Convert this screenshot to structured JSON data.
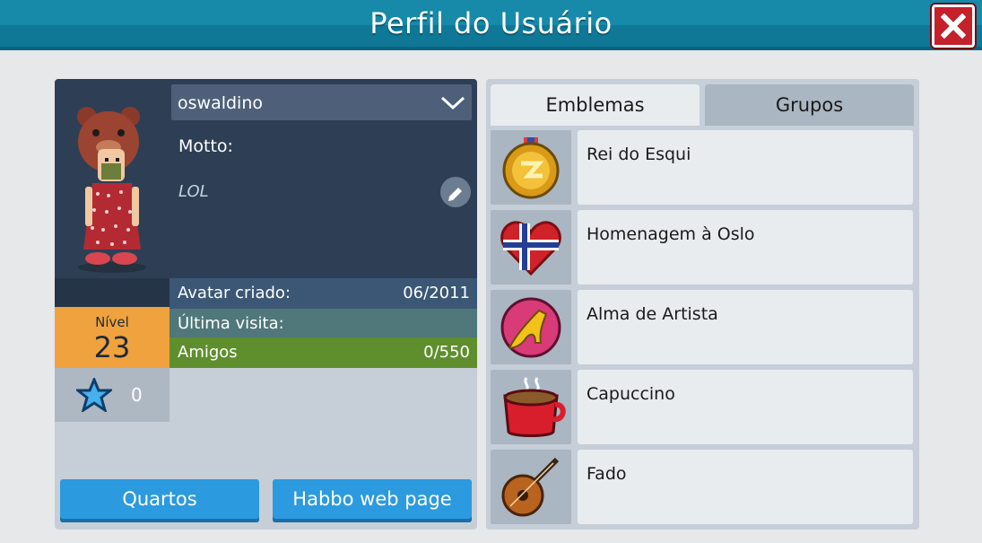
{
  "window": {
    "title": "Perfil do Usuário",
    "close_icon": "close-icon"
  },
  "profile": {
    "username": "oswaldino",
    "motto_label": "Motto:",
    "motto_value": "LOL",
    "stats": {
      "created_label": "Avatar criado:",
      "created_value": "06/2011",
      "last_visit_label": "Última visita:",
      "last_visit_value": "",
      "friends_label": "Amigos",
      "friends_value": "0/550"
    },
    "level_label": "Nível",
    "level_value": "23",
    "stars_value": "0"
  },
  "buttons": {
    "rooms": "Quartos",
    "web_page": "Habbo web page"
  },
  "tabs": [
    {
      "label": "Emblemas",
      "active": true
    },
    {
      "label": "Grupos",
      "active": false
    }
  ],
  "badges": [
    {
      "label": "Rei do Esqui",
      "icon": "gold-medal-icon"
    },
    {
      "label": "Homenagem à Oslo",
      "icon": "norway-heart-icon"
    },
    {
      "label": "Alma de Artista",
      "icon": "high-heel-icon"
    },
    {
      "label": "Capuccino",
      "icon": "coffee-cup-icon"
    },
    {
      "label": "Fado",
      "icon": "mandolin-icon"
    }
  ],
  "colors": {
    "titlebar": "#1789a9",
    "close": "#c5212a",
    "level": "#f0a23e",
    "friends": "#5f8f2d",
    "button": "#2c9ade"
  }
}
